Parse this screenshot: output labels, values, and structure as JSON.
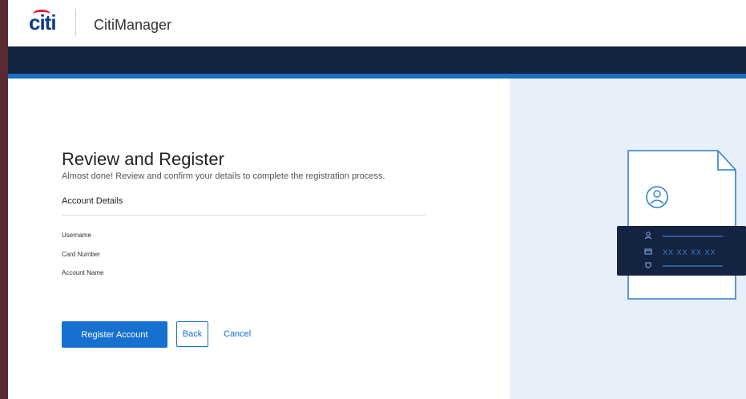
{
  "header": {
    "logo_text": "citi",
    "app_title": "CitiManager"
  },
  "page": {
    "title": "Review and Register",
    "subtitle": "Almost done! Review and confirm your details to complete the registration process."
  },
  "account_details": {
    "section_title": "Account Details",
    "fields": [
      {
        "label": "Username"
      },
      {
        "label": "Card Number"
      },
      {
        "label": "Account Name"
      }
    ]
  },
  "actions": {
    "register_label": "Register Account",
    "back_label": "Back",
    "cancel_label": "Cancel"
  },
  "illustration": {
    "card_number_mask": "XX XX XX XX",
    "icons": [
      "user-icon",
      "card-icon",
      "shield-icon",
      "user-circle-icon"
    ]
  },
  "colors": {
    "brand_blue": "#0f3c8a",
    "brand_red": "#e31837",
    "nav_dark": "#142341",
    "accent_blue": "#1b6ec2",
    "button_blue": "#1570cf",
    "side_panel_bg": "#e7f0fa"
  }
}
